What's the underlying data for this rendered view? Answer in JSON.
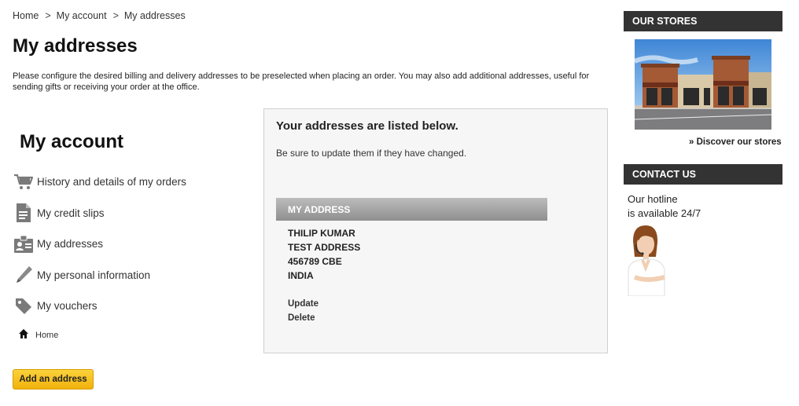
{
  "breadcrumb": {
    "home": "Home",
    "separator": ">",
    "account": "My account",
    "current": "My addresses"
  },
  "page": {
    "title": "My addresses",
    "intro": "Please configure the desired billing and delivery addresses to be preselected when placing an order. You may also add additional addresses, useful for sending gifts or receiving your order at the office."
  },
  "account": {
    "title": "My account",
    "items": [
      {
        "label": "History and details of my orders",
        "icon": "cart-icon"
      },
      {
        "label": "My credit slips",
        "icon": "document-icon"
      },
      {
        "label": "My addresses",
        "icon": "address-card-icon"
      },
      {
        "label": "My personal information",
        "icon": "pencil-icon"
      },
      {
        "label": "My vouchers",
        "icon": "tag-icon"
      }
    ],
    "home_label": "Home"
  },
  "add_address_label": "Add an address",
  "addresses_panel": {
    "title": "Your addresses are listed below.",
    "subtitle": "Be sure to update them if they have changed.",
    "address_heading": "MY ADDRESS",
    "lines": [
      "THILIP KUMAR",
      "TEST ADDRESS",
      "456789 CBE",
      "INDIA"
    ],
    "update_label": "Update",
    "delete_label": "Delete"
  },
  "sidebar": {
    "stores_heading": "OUR STORES",
    "discover_label": "» Discover our stores",
    "contact_heading": "CONTACT US",
    "hotline_line1": "Our hotline",
    "hotline_line2": "is available 24/7"
  },
  "colors": {
    "accent_button": "#f5c21a",
    "sidebar_header": "#333333",
    "panel_bg": "#f6f6f6"
  }
}
